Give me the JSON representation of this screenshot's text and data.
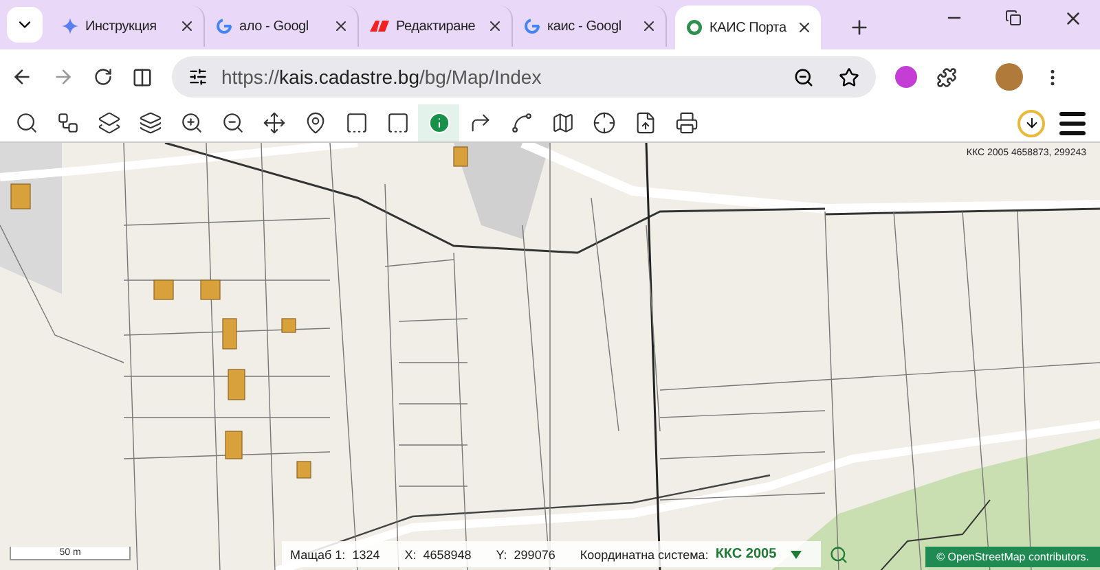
{
  "browser": {
    "tabs": [
      {
        "title": "Инструкция",
        "kind": "sparkle",
        "selected": false
      },
      {
        "title": "ало - Googl",
        "kind": "google",
        "selected": false
      },
      {
        "title": "Редактиране",
        "kind": "brand",
        "selected": false
      },
      {
        "title": "каис - Googl",
        "kind": "google",
        "selected": false
      },
      {
        "title": "КАИС Порта",
        "kind": "kais",
        "selected": true
      }
    ],
    "url_host": "kais.cadastre.bg",
    "url_scheme": "https://",
    "url_path": "/bg/Map/Index"
  },
  "toolbar": {
    "tools": [
      {
        "selected": false
      },
      {
        "selected": false
      },
      {
        "selected": false
      },
      {
        "selected": false
      },
      {
        "selected": false
      },
      {
        "selected": false
      },
      {
        "selected": false
      },
      {
        "selected": false
      },
      {
        "selected": false
      },
      {
        "selected": false
      },
      {
        "selected": true
      },
      {
        "selected": false
      },
      {
        "selected": false
      },
      {
        "selected": false
      },
      {
        "selected": false
      },
      {
        "selected": false
      },
      {
        "selected": false
      }
    ]
  },
  "map": {
    "coordinate_readout": "ККС 2005 4658873, 299243",
    "scale_bar": "50 m",
    "status": {
      "scale_label": "Мащаб 1:",
      "scale_value": "1324",
      "x_label": "X:",
      "x_value": "4658948",
      "y_label": "Y:",
      "y_value": "299076",
      "crs_label": "Координатна система:",
      "crs_value": "ККС 2005"
    },
    "attribution": "© OpenStreetMap contributors."
  }
}
